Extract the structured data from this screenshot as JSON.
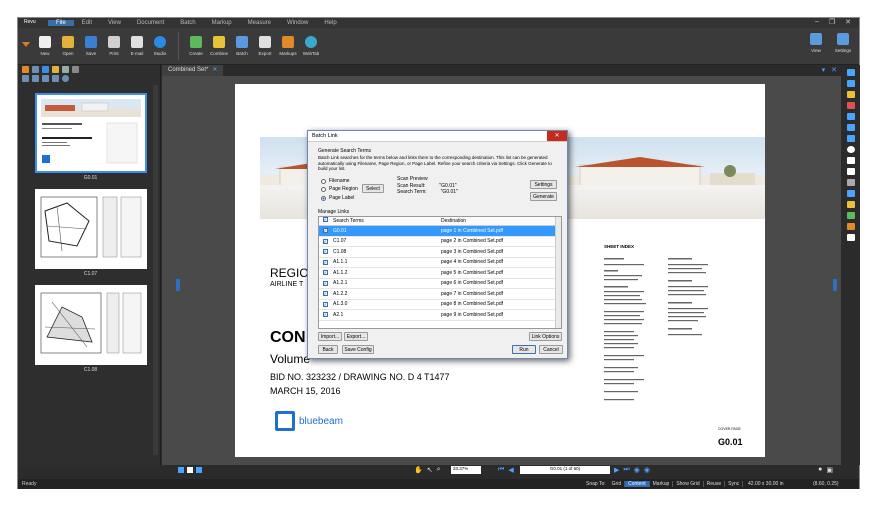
{
  "menubar": {
    "logo": "Revu",
    "items": [
      "File",
      "Edit",
      "View",
      "Document",
      "Batch",
      "Markup",
      "Measure",
      "Window",
      "Help"
    ]
  },
  "toolbar": {
    "buttons": [
      {
        "label": "New",
        "icon": "new-doc-icon",
        "color": "#f0f0f0"
      },
      {
        "label": "Open",
        "icon": "folder-open-icon",
        "color": "#e2b23c"
      },
      {
        "label": "Save",
        "icon": "save-icon",
        "color": "#3b7fd4"
      },
      {
        "label": "Print",
        "icon": "printer-icon",
        "color": "#d0d0d0"
      },
      {
        "label": "E-mail",
        "icon": "email-icon",
        "color": "#e0e0e0"
      },
      {
        "label": "Studio",
        "icon": "studio-icon",
        "color": "#2a8ce0"
      }
    ],
    "buttons2": [
      {
        "label": "Create",
        "icon": "create-icon",
        "color": "#5cba5c"
      },
      {
        "label": "Combine",
        "icon": "combine-icon",
        "color": "#e6c33a"
      },
      {
        "label": "Batch",
        "icon": "batch-icon",
        "color": "#5a9be0"
      },
      {
        "label": "Export",
        "icon": "export-icon",
        "color": "#e0e0e0"
      },
      {
        "label": "Markups",
        "icon": "markups-icon",
        "color": "#e08a2a"
      },
      {
        "label": "WebTab",
        "icon": "webtab-icon",
        "color": "#3aa8c8"
      }
    ],
    "right": [
      {
        "label": "View",
        "icon": "monitor-icon",
        "color": "#5a9be0"
      },
      {
        "label": "Settings",
        "icon": "settings-icon",
        "color": "#5a9be0"
      }
    ]
  },
  "tab": {
    "label": "Combined Set*",
    "close": "✕"
  },
  "thumbnails": [
    {
      "label": "G0.01",
      "selected": true
    },
    {
      "label": "C1.07",
      "selected": false
    },
    {
      "label": "C1.08",
      "selected": false
    }
  ],
  "document": {
    "region": "REGIO",
    "airline": "AIRLINE T",
    "con": "CON",
    "volume": "Volume",
    "bid": "BID NO. 323232 / DRAWING NO. D 4 T1477",
    "date": "MARCH 15, 2016",
    "logo_text": "bluebeam",
    "sheet_index": "SHEET INDEX",
    "comp_page": "COVER PAGE",
    "sheet_no": "G0.01"
  },
  "bottombar": {
    "zoom": "33.37%",
    "page": "G0.01 (1 of 60)"
  },
  "statusbar": {
    "ready": "Ready",
    "snap_to": "Snap To:",
    "toggles": [
      {
        "label": "Grid",
        "on": false
      },
      {
        "label": "Content",
        "on": true
      },
      {
        "label": "Markup",
        "on": false
      },
      {
        "label": "Show Grid",
        "on": false
      },
      {
        "label": "Reuse",
        "on": false
      },
      {
        "label": "Sync",
        "on": false
      }
    ],
    "dims": "42.00 x 30.00 in",
    "coords": "(8.60, 0.25)"
  },
  "dialog": {
    "title": "Batch Link",
    "close": "✕",
    "section_title": "Generate Search Terms",
    "description": "Batch Link searches for the terms below and links them to the corresponding destination. This list can be generated automatically using Filename, Page Region, or Page Label. Refine your search criteria via Settings. Click Generate to build your list.",
    "options": [
      {
        "label": "Filename",
        "on": false
      },
      {
        "label": "Page Region",
        "on": false
      },
      {
        "label": "Page Label",
        "on": true
      }
    ],
    "select_label": "Select",
    "scan_preview": "Scan Preview",
    "scan_result_label": "Scan Result:",
    "scan_result_value": "\"G0.01\"",
    "search_term_label": "Search Term:",
    "search_term_value": "\"G0.01\"",
    "settings_label": "Settings",
    "generate_label": "Generate",
    "manage_links": "Manage Links",
    "col_terms": "Search Terms",
    "col_dest": "Destination",
    "rows": [
      {
        "term": "G0.01",
        "dest": "page 1 in Combined Set.pdf",
        "selected": true
      },
      {
        "term": "C1.07",
        "dest": "page 2 in Combined Set.pdf",
        "selected": false
      },
      {
        "term": "C1.08",
        "dest": "page 3 in Combined Set.pdf",
        "selected": false
      },
      {
        "term": "A1.1.1",
        "dest": "page 4 in Combined Set.pdf",
        "selected": false
      },
      {
        "term": "A1.1.2",
        "dest": "page 5 in Combined Set.pdf",
        "selected": false
      },
      {
        "term": "A1.2.1",
        "dest": "page 6 in Combined Set.pdf",
        "selected": false
      },
      {
        "term": "A1.2.2",
        "dest": "page 7 in Combined Set.pdf",
        "selected": false
      },
      {
        "term": "A1.3.0",
        "dest": "page 8 in Combined Set.pdf",
        "selected": false
      },
      {
        "term": "A2.1",
        "dest": "page 9 in Combined Set.pdf",
        "selected": false
      }
    ],
    "import_label": "Import...",
    "export_label": "Export...",
    "link_options_label": "Link Options",
    "back_label": "Back",
    "save_config_label": "Save Config",
    "run_label": "Run",
    "cancel_label": "Cancel"
  }
}
